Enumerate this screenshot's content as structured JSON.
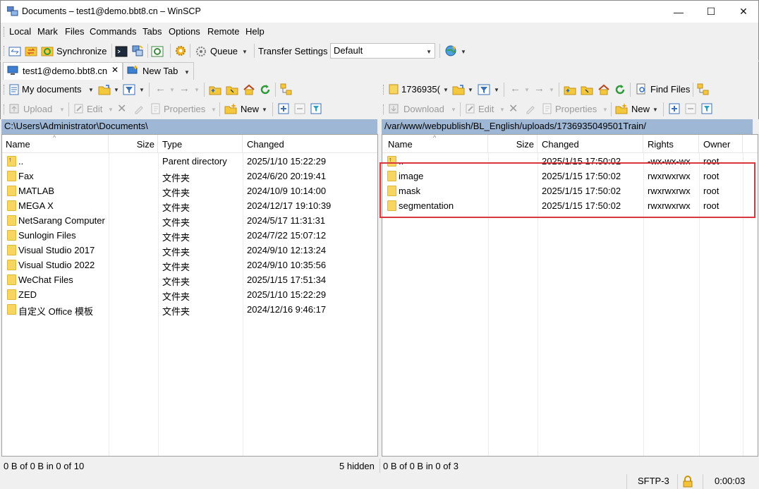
{
  "window": {
    "title": "Documents – test1@demo.bbt8.cn – WinSCP",
    "minimize_glyph": "—",
    "maximize_glyph": "☐",
    "close_glyph": "✕"
  },
  "menu": [
    "Local",
    "Mark",
    "Files",
    "Commands",
    "Tabs",
    "Options",
    "Remote",
    "Help"
  ],
  "toolbar": {
    "synchronize_label": "Synchronize",
    "queue_label": "Queue",
    "transfer_settings_label": "Transfer Settings",
    "transfer_settings_value": "Default"
  },
  "tabs": {
    "active_label": "test1@demo.bbt8.cn",
    "new_tab_label": "New Tab"
  },
  "left_panel": {
    "location_label": "My documents",
    "upload_label": "Upload",
    "edit_label": "Edit",
    "properties_label": "Properties",
    "new_label": "New",
    "path": "C:\\Users\\Administrator\\Documents\\",
    "columns": [
      "Name",
      "Size",
      "Type",
      "Changed"
    ],
    "rows": [
      {
        "name": "..",
        "size": "",
        "type": "Parent directory",
        "changed": "2025/1/10 15:22:29",
        "icon": "parent-dir-icon"
      },
      {
        "name": "Fax",
        "size": "",
        "type": "文件夹",
        "changed": "2024/6/20 20:19:41",
        "icon": "folder-icon"
      },
      {
        "name": "MATLAB",
        "size": "",
        "type": "文件夹",
        "changed": "2024/10/9 10:14:00",
        "icon": "folder-icon"
      },
      {
        "name": "MEGA X",
        "size": "",
        "type": "文件夹",
        "changed": "2024/12/17 19:10:39",
        "icon": "folder-icon"
      },
      {
        "name": "NetSarang Computer",
        "size": "",
        "type": "文件夹",
        "changed": "2024/5/17 11:31:31",
        "icon": "folder-icon"
      },
      {
        "name": "Sunlogin Files",
        "size": "",
        "type": "文件夹",
        "changed": "2024/7/22 15:07:12",
        "icon": "folder-icon"
      },
      {
        "name": "Visual Studio 2017",
        "size": "",
        "type": "文件夹",
        "changed": "2024/9/10 12:13:24",
        "icon": "folder-icon"
      },
      {
        "name": "Visual Studio 2022",
        "size": "",
        "type": "文件夹",
        "changed": "2024/9/10 10:35:56",
        "icon": "folder-icon"
      },
      {
        "name": "WeChat Files",
        "size": "",
        "type": "文件夹",
        "changed": "2025/1/15 17:51:34",
        "icon": "folder-icon"
      },
      {
        "name": "ZED",
        "size": "",
        "type": "文件夹",
        "changed": "2025/1/10 15:22:29",
        "icon": "folder-icon"
      },
      {
        "name": "自定义 Office 模板",
        "size": "",
        "type": "文件夹",
        "changed": "2024/12/16 9:46:17",
        "icon": "folder-icon"
      }
    ],
    "status": "0 B of 0 B in 0 of 10",
    "hidden": "5 hidden"
  },
  "right_panel": {
    "location_label": "1736935(",
    "find_files_label": "Find Files",
    "download_label": "Download",
    "edit_label": "Edit",
    "properties_label": "Properties",
    "new_label": "New",
    "path": "/var/www/webpublish/BL_English/uploads/1736935049501Train/",
    "columns": [
      "Name",
      "Size",
      "Changed",
      "Rights",
      "Owner"
    ],
    "rows": [
      {
        "name": "..",
        "size": "",
        "changed": "2025/1/15 17:50:02",
        "rights": "-wx-wx-wx",
        "owner": "root",
        "icon": "parent-dir-icon"
      },
      {
        "name": "image",
        "size": "",
        "changed": "2025/1/15 17:50:02",
        "rights": "rwxrwxrwx",
        "owner": "root",
        "icon": "folder-icon"
      },
      {
        "name": "mask",
        "size": "",
        "changed": "2025/1/15 17:50:02",
        "rights": "rwxrwxrwx",
        "owner": "root",
        "icon": "folder-icon"
      },
      {
        "name": "segmentation",
        "size": "",
        "changed": "2025/1/15 17:50:02",
        "rights": "rwxrwxrwx",
        "owner": "root",
        "icon": "folder-icon"
      }
    ],
    "status": "0 B of 0 B in 0 of 3"
  },
  "bottom": {
    "protocol": "SFTP-3",
    "elapsed": "0:00:03"
  },
  "colors": {
    "path_bar": "#9eb7d4",
    "highlight_box": "#d9363e",
    "folder": "#f7d561"
  }
}
